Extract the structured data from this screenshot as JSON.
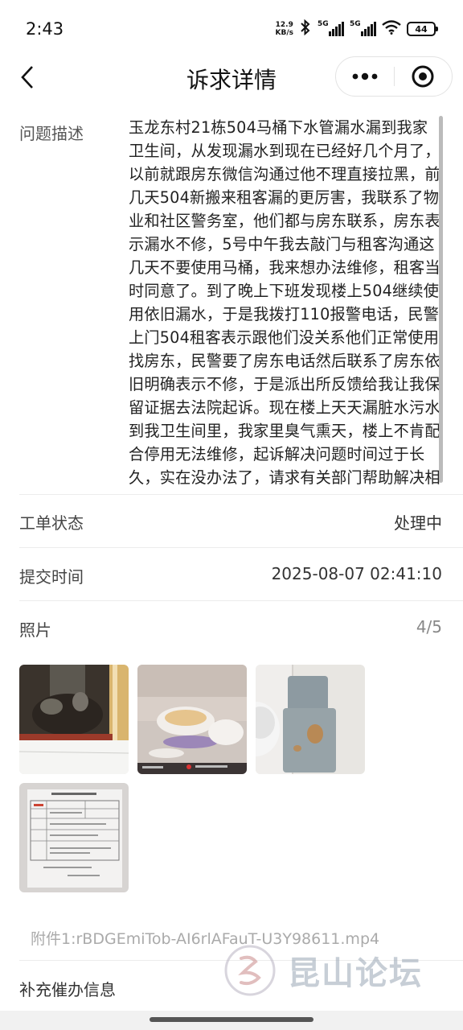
{
  "status_bar": {
    "time": "2:43",
    "net_speed_value": "12.9",
    "net_speed_unit": "KB/s",
    "sim1_tag": "5G",
    "sim2_tag": "5G",
    "battery": "44"
  },
  "nav": {
    "title": "诉求详情"
  },
  "problem": {
    "label": "问题描述",
    "text": "玉龙东村21栋504马桶下水管漏水漏到我家卫生间，从发现漏水到现在已经好几个月了，以前就跟房东微信沟通过他不理直接拉黑，前几天504新搬来租客漏的更厉害，我联系了物业和社区警务室，他们都与房东联系，房东表示漏水不修，5号中午我去敲门与租客沟通这几天不要使用马桶，我来想办法维修，租客当时同意了。到了晚上下班发现楼上504继续使用依旧漏水，于是我拨打110报警电话，民警上门504租客表示跟他们没关系他们正常使用找房东，民警要了房东电话然后联系了房东依旧明确表示不修，于是派出所反馈给我让我保留证据去法院起诉。现在楼上天天漏脏水污水到我卫生间里，我家里臭气熏天，楼上不肯配合停用无法维修，起诉解决问题时间过于长久，实在没办法了，请求有关部门帮助解决相关问题。"
  },
  "status": {
    "label": "工单状态",
    "value": "处理中"
  },
  "submit_time": {
    "label": "提交时间",
    "value": "2025-08-07 02:41:10"
  },
  "photos": {
    "label": "照片",
    "count": "4/5"
  },
  "attachment": {
    "text": "附件1:rBDGEmiTob-AI6rlAFauT-U3Y98611.mp4"
  },
  "extra": {
    "label": "补充催办信息"
  },
  "watermark": {
    "text": "昆山论坛"
  }
}
